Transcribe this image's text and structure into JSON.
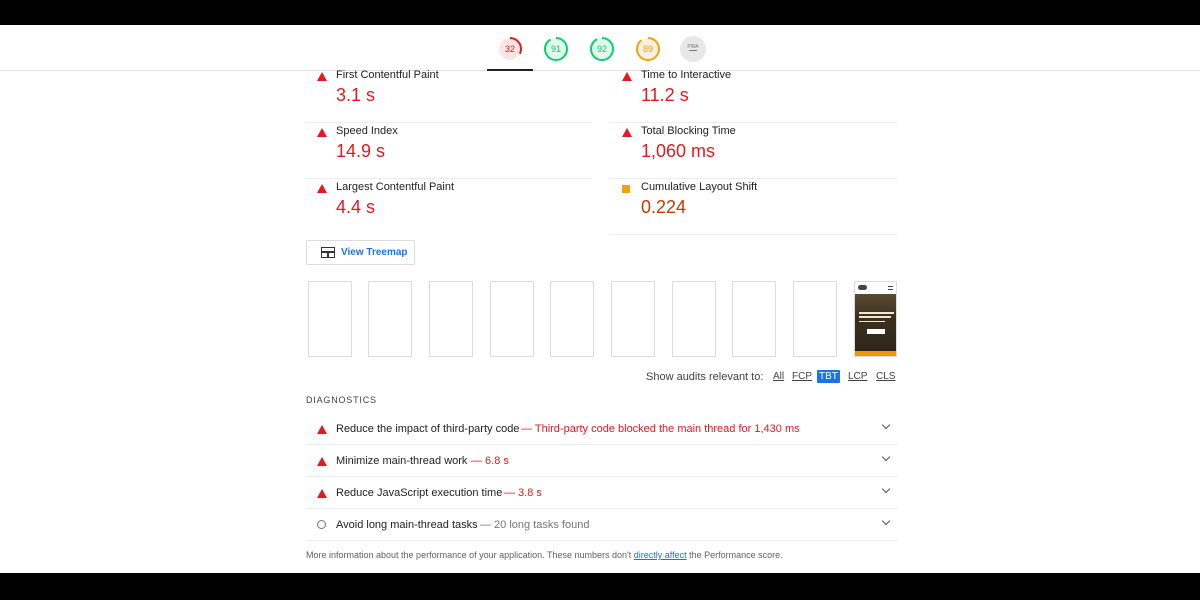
{
  "colors": {
    "fail": "#e5181f",
    "average": "#f0a30a",
    "pass": "#0cce6b",
    "link": "#1a73e8"
  },
  "gauges": [
    {
      "score": 32,
      "color": "#e5181f",
      "track": "#fde5e5",
      "fraction": 0.32,
      "selected": true
    },
    {
      "score": 91,
      "color": "#0cce6b",
      "track": "#e1f8ec",
      "fraction": 0.91
    },
    {
      "score": 92,
      "color": "#0cce6b",
      "track": "#e1f8ec",
      "fraction": 0.92
    },
    {
      "score": 89,
      "color": "#f0a30a",
      "track": "#fdf1dd",
      "fraction": 0.89
    }
  ],
  "gauge_pwa": {
    "label": "PWA",
    "icon": "pwa-badge-icon"
  },
  "metrics": [
    {
      "label": "First Contentful Paint",
      "value": "3.1 s",
      "status": "fail",
      "icon": "triangle-fail-icon"
    },
    {
      "label": "Time to Interactive",
      "value": "11.2 s",
      "status": "fail",
      "icon": "triangle-fail-icon"
    },
    {
      "label": "Speed Index",
      "value": "14.9 s",
      "status": "fail",
      "icon": "triangle-fail-icon"
    },
    {
      "label": "Total Blocking Time",
      "value": "1,060 ms",
      "status": "fail",
      "icon": "triangle-fail-icon"
    },
    {
      "label": "Largest Contentful Paint",
      "value": "4.4 s",
      "status": "fail",
      "icon": "triangle-fail-icon"
    },
    {
      "label": "Cumulative Layout Shift",
      "value": "0.224",
      "status": "average",
      "icon": "square-average-icon"
    }
  ],
  "treemap": {
    "label": "View Treemap",
    "icon": "treemap-icon"
  },
  "filter": {
    "label": "Show audits relevant to:",
    "chips": [
      {
        "label": "All",
        "active": false
      },
      {
        "label": "FCP",
        "active": false
      },
      {
        "label": "TBT",
        "active": true
      },
      {
        "label": "LCP",
        "active": false
      },
      {
        "label": "CLS",
        "active": false
      }
    ]
  },
  "diagnostics": {
    "header": "DIAGNOSTICS",
    "audits": [
      {
        "title": "Reduce the impact of third-party code",
        "detail": "— Third-party code blocked the main thread for 1,430 ms",
        "status": "fail"
      },
      {
        "title": "Minimize main-thread work",
        "detail": "— 6.8 s",
        "status": "fail"
      },
      {
        "title": "Reduce JavaScript execution time",
        "detail": "— 3.8 s",
        "status": "fail"
      },
      {
        "title": "Avoid long main-thread tasks",
        "detail": "— 20 long tasks found",
        "status": "info"
      }
    ]
  },
  "footer": {
    "pre": "More information about the performance of your application. These numbers don't ",
    "link": "directly affect",
    "post": " the Performance score."
  }
}
